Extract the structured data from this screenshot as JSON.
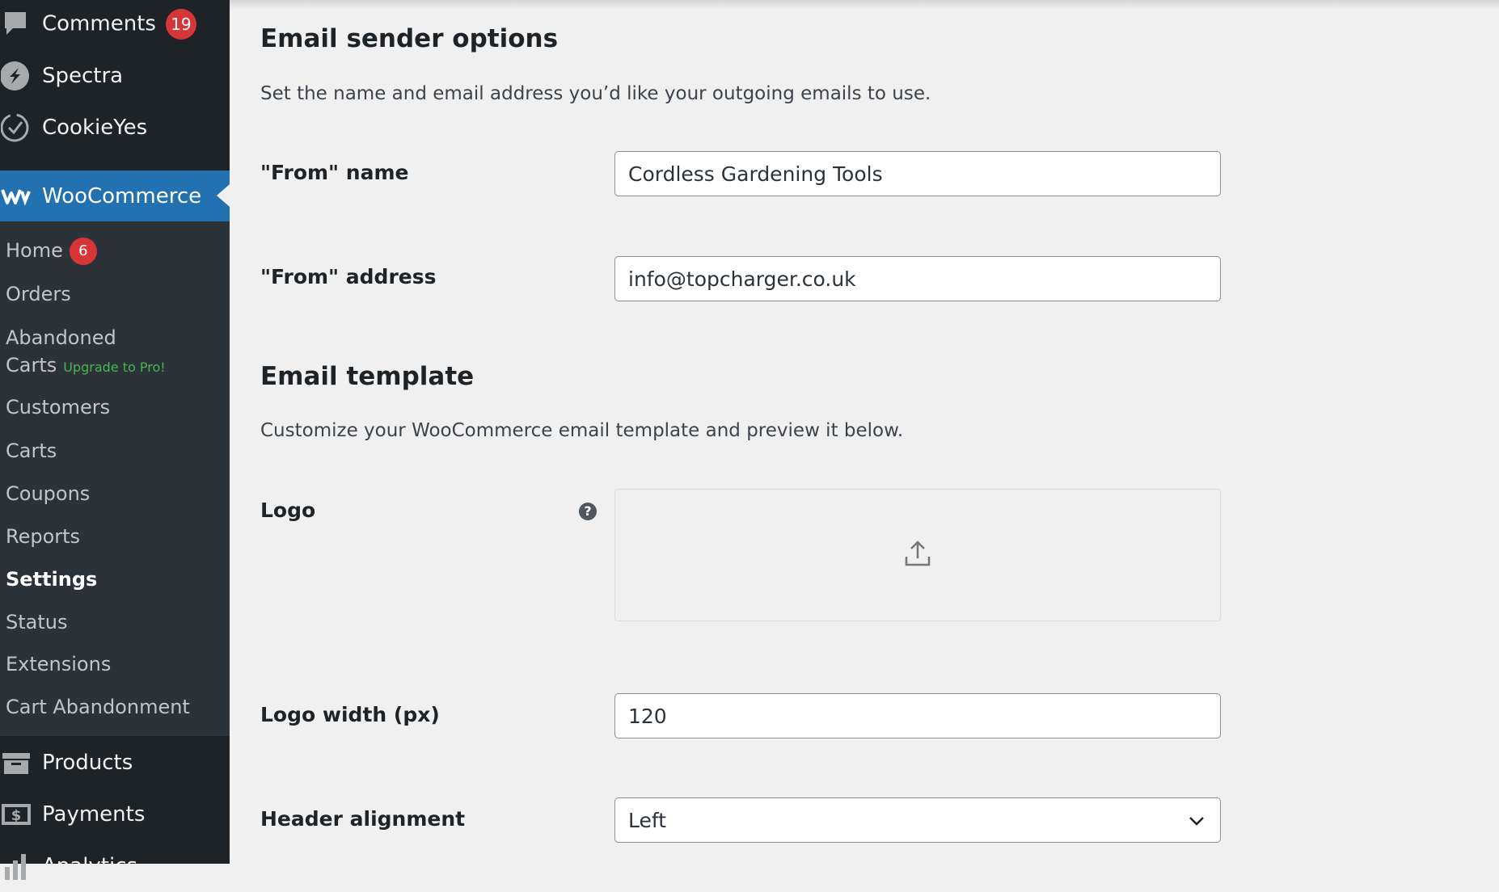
{
  "sidebar": {
    "top_items": [
      {
        "label": "Comments",
        "badge": "19",
        "icon": "comment-icon"
      },
      {
        "label": "Spectra",
        "icon": "spectra-icon"
      },
      {
        "label": "CookieYes",
        "icon": "cookie-icon"
      }
    ],
    "woocommerce": {
      "label": "WooCommerce",
      "icon": "woocommerce-icon"
    },
    "submenu": [
      {
        "label": "Home",
        "badge": "6"
      },
      {
        "label": "Orders"
      },
      {
        "label": "Abandoned",
        "label2": "Carts",
        "extra": "Upgrade to Pro!"
      },
      {
        "label": "Customers"
      },
      {
        "label": "Carts"
      },
      {
        "label": "Coupons"
      },
      {
        "label": "Reports"
      },
      {
        "label": "Settings",
        "current": true
      },
      {
        "label": "Status"
      },
      {
        "label": "Extensions"
      },
      {
        "label": "Cart Abandonment"
      }
    ],
    "bottom_items": [
      {
        "label": "Products",
        "icon": "archive-icon"
      },
      {
        "label": "Payments",
        "icon": "payments-icon"
      },
      {
        "label": "Analytics",
        "icon": "chart-icon"
      }
    ],
    "colors": {
      "bg": "#1d2327",
      "submenu_bg": "#2c3338",
      "active": "#2271b1",
      "badge": "#d63638"
    }
  },
  "sender": {
    "title": "Email sender options",
    "description": "Set the name and email address you’d like your outgoing emails to use.",
    "from_name_label": "\"From\" name",
    "from_name_value": "Cordless Gardening Tools",
    "from_address_label": "\"From\" address",
    "from_address_value": "info@topcharger.co.uk"
  },
  "template": {
    "title": "Email template",
    "description": "Customize your WooCommerce email template and preview it below.",
    "logo_label": "Logo",
    "help_glyph": "?",
    "upload_icon": "upload-icon",
    "logo_width_label": "Logo width (px)",
    "logo_width_value": "120",
    "header_alignment_label": "Header alignment",
    "header_alignment_value": "Left"
  }
}
